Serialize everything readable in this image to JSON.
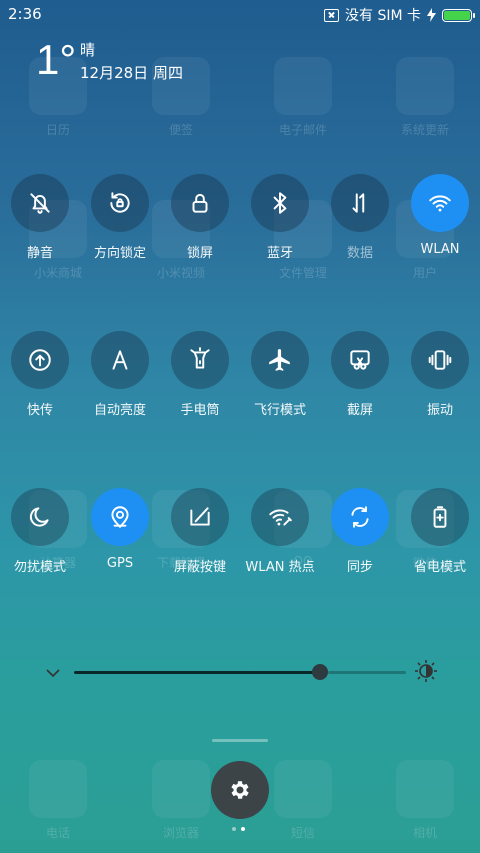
{
  "status_bar": {
    "time": "2:36",
    "sim_text": "没有 SIM 卡",
    "icons": [
      "no-sim-icon",
      "charging-icon",
      "battery-icon"
    ],
    "battery_color": "#45d34b"
  },
  "weather": {
    "temperature": "1°",
    "condition": "晴",
    "date": "12月28日 周四"
  },
  "toggles": [
    {
      "label": "静音",
      "icon": "bell-off-icon",
      "on": false
    },
    {
      "label": "方向锁定",
      "icon": "rotation-lock-icon",
      "on": false
    },
    {
      "label": "锁屏",
      "icon": "lock-icon",
      "on": false
    },
    {
      "label": "蓝牙",
      "icon": "bluetooth-icon",
      "on": false
    },
    {
      "label": "数据",
      "icon": "mobile-data-icon",
      "on": false
    },
    {
      "label": "WLAN",
      "icon": "wifi-icon",
      "on": true
    },
    {
      "label": "快传",
      "icon": "quick-transfer-icon",
      "on": false
    },
    {
      "label": "自动亮度",
      "icon": "auto-brightness-icon",
      "on": false
    },
    {
      "label": "手电筒",
      "icon": "flashlight-icon",
      "on": false
    },
    {
      "label": "飞行模式",
      "icon": "airplane-icon",
      "on": false
    },
    {
      "label": "截屏",
      "icon": "screenshot-icon",
      "on": false
    },
    {
      "label": "振动",
      "icon": "vibrate-icon",
      "on": false
    },
    {
      "label": "勿扰模式",
      "icon": "moon-icon",
      "on": false
    },
    {
      "label": "GPS",
      "icon": "gps-icon",
      "on": true
    },
    {
      "label": "屏蔽按键",
      "icon": "button-block-icon",
      "on": false
    },
    {
      "label": "WLAN 热点",
      "icon": "hotspot-icon",
      "on": false
    },
    {
      "label": "同步",
      "icon": "sync-icon",
      "on": true
    },
    {
      "label": "省电模式",
      "icon": "battery-saver-icon",
      "on": false
    }
  ],
  "brightness": {
    "level": 0.74
  },
  "background_apps": {
    "row1": [
      "日历",
      "便签",
      "电子邮件",
      "系统更新"
    ],
    "row2": [
      "小米商城",
      "小米视频",
      "文件管理",
      "用户"
    ],
    "row3": [
      "计算器",
      "下载管理",
      "QQ",
      "微信"
    ],
    "dock": [
      "电话",
      "浏览器",
      "短信",
      "相机"
    ]
  },
  "page_indicator": {
    "pages": 2,
    "current": 2
  },
  "colors": {
    "accent": "#1e8ff3",
    "toggle_off_bg": "rgba(20,40,60,0.35)",
    "settings_button_bg": "#3d4448"
  }
}
